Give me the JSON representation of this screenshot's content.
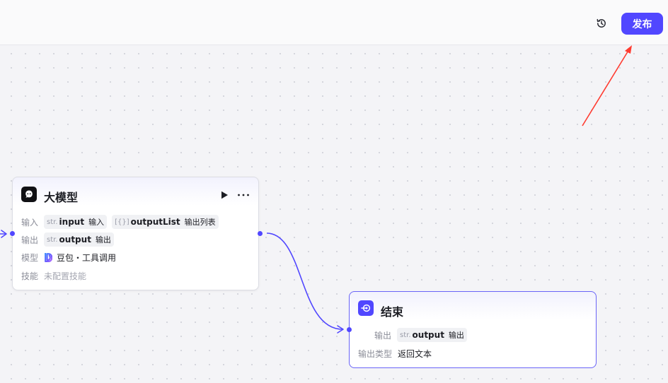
{
  "header": {
    "history_icon": "history-icon",
    "publish_label": "发布",
    "accent": "#5147ff"
  },
  "llm_node": {
    "title": "大模型",
    "icon": "llm-icon",
    "input_label": "输入",
    "inputs": [
      {
        "type": "str.",
        "name": "input",
        "desc": "输入"
      },
      {
        "type": "[{}]",
        "name": "outputList",
        "desc": "输出列表"
      }
    ],
    "output_label": "输出",
    "outputs": [
      {
        "type": "str.",
        "name": "output",
        "desc": "输出"
      }
    ],
    "model_label": "模型",
    "model_value": "豆包・工具调用",
    "skill_label": "技能",
    "skill_value": "未配置技能"
  },
  "end_node": {
    "title": "结束",
    "icon": "end-icon",
    "output_label": "输出",
    "outputs": [
      {
        "type": "str.",
        "name": "output",
        "desc": "输出"
      }
    ],
    "output_type_label": "输出类型",
    "output_type_value": "返回文本"
  },
  "annotation": {
    "arrow_color": "#ff3b30"
  },
  "edge_color": "#5147ff"
}
